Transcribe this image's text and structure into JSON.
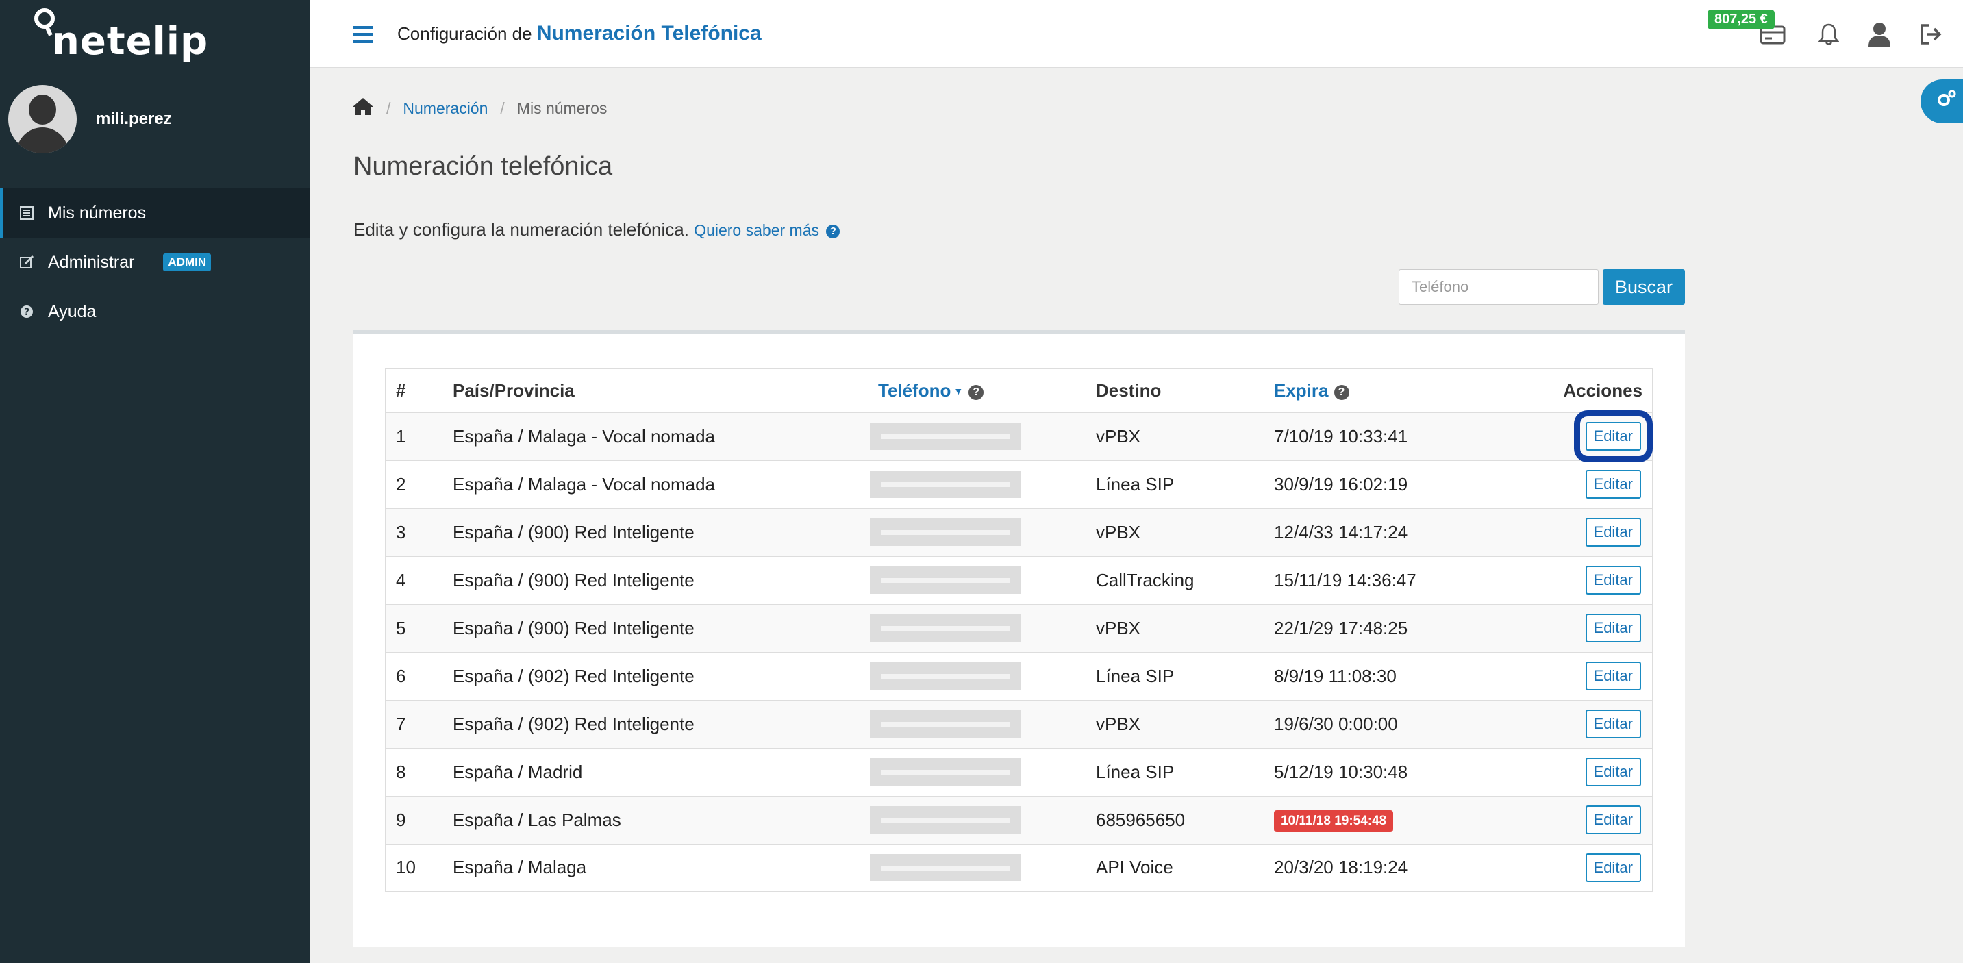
{
  "brand": {
    "logo_text": "netelip"
  },
  "user": {
    "name": "mili.perez"
  },
  "sidebar": {
    "items": [
      {
        "label": "Mis números",
        "icon": "list-icon",
        "active": true
      },
      {
        "label": "Administrar",
        "icon": "edit-icon",
        "badge": "ADMIN"
      },
      {
        "label": "Ayuda",
        "icon": "question-icon"
      }
    ]
  },
  "topbar": {
    "title_prefix": "Configuración de",
    "title_strong": "Numeración Telefónica",
    "balance": "807,25 €"
  },
  "breadcrumb": {
    "link": "Numeración",
    "current": "Mis números"
  },
  "page": {
    "title": "Numeración telefónica",
    "description": "Edita y configura la numeración telefónica.",
    "help_link": "Quiero saber más"
  },
  "search": {
    "placeholder": "Teléfono",
    "button": "Buscar"
  },
  "table": {
    "headers": {
      "num": "#",
      "country": "País/Provincia",
      "phone": "Teléfono",
      "destination": "Destino",
      "expires": "Expira",
      "actions": "Acciones"
    },
    "edit_label": "Editar",
    "rows": [
      {
        "n": "1",
        "country": "España / Malaga - Vocal nomada",
        "destination": "vPBX",
        "expires": "7/10/19 10:33:41"
      },
      {
        "n": "2",
        "country": "España / Malaga - Vocal nomada",
        "destination": "Línea SIP",
        "expires": "30/9/19 16:02:19"
      },
      {
        "n": "3",
        "country": "España / (900) Red Inteligente",
        "destination": "vPBX",
        "expires": "12/4/33 14:17:24"
      },
      {
        "n": "4",
        "country": "España / (900) Red Inteligente",
        "destination": "CallTracking",
        "expires": "15/11/19 14:36:47"
      },
      {
        "n": "5",
        "country": "España / (900) Red Inteligente",
        "destination": "vPBX",
        "expires": "22/1/29 17:48:25"
      },
      {
        "n": "6",
        "country": "España / (902) Red Inteligente",
        "destination": "Línea SIP",
        "expires": "8/9/19 11:08:30"
      },
      {
        "n": "7",
        "country": "España / (902) Red Inteligente",
        "destination": "vPBX",
        "expires": "19/6/30 0:00:00"
      },
      {
        "n": "8",
        "country": "España / Madrid",
        "destination": "Línea SIP",
        "expires": "5/12/19 10:30:48"
      },
      {
        "n": "9",
        "country": "España / Las Palmas",
        "destination": "685965650",
        "expires": "10/11/18 19:54:48"
      },
      {
        "n": "10",
        "country": "España / Malaga",
        "destination": "API Voice",
        "expires": "20/3/20 18:19:24"
      }
    ]
  }
}
